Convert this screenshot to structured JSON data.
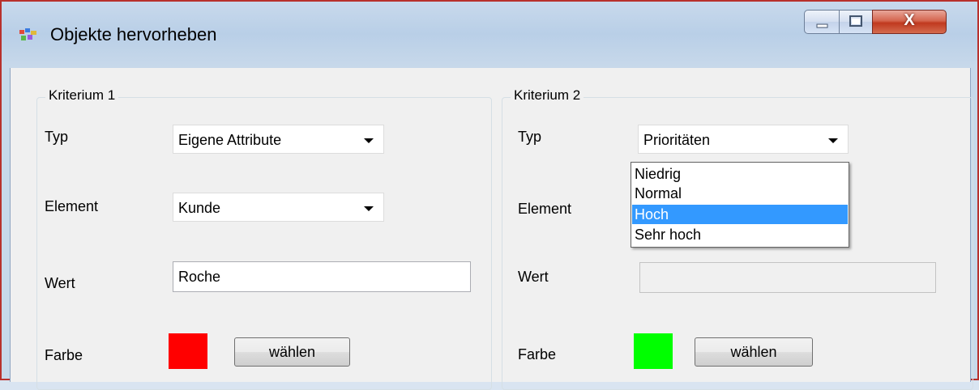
{
  "window": {
    "title": "Objekte hervorheben",
    "close_glyph": "X"
  },
  "criterion1": {
    "legend": "Kriterium  1",
    "typ_label": "Typ",
    "typ_value": "Eigene Attribute",
    "element_label": "Element",
    "element_value": "Kunde",
    "wert_label": "Wert",
    "wert_value": "Roche",
    "farbe_label": "Farbe",
    "color": "#ff0000",
    "choose_button": "wählen"
  },
  "criterion2": {
    "legend": "Kriterium 2",
    "typ_label": "Typ",
    "typ_value": "Prioritäten",
    "element_label": "Element",
    "element_value": "",
    "wert_label": "Wert",
    "wert_value": "",
    "farbe_label": "Farbe",
    "color": "#00ff00",
    "choose_button": "wählen",
    "dropdown_options": [
      "Niedrig",
      "Normal",
      "Hoch",
      "Sehr hoch"
    ],
    "dropdown_highlighted": "Hoch"
  },
  "colors": {
    "selection": "#3399ff",
    "close_button": "#c0391f"
  }
}
